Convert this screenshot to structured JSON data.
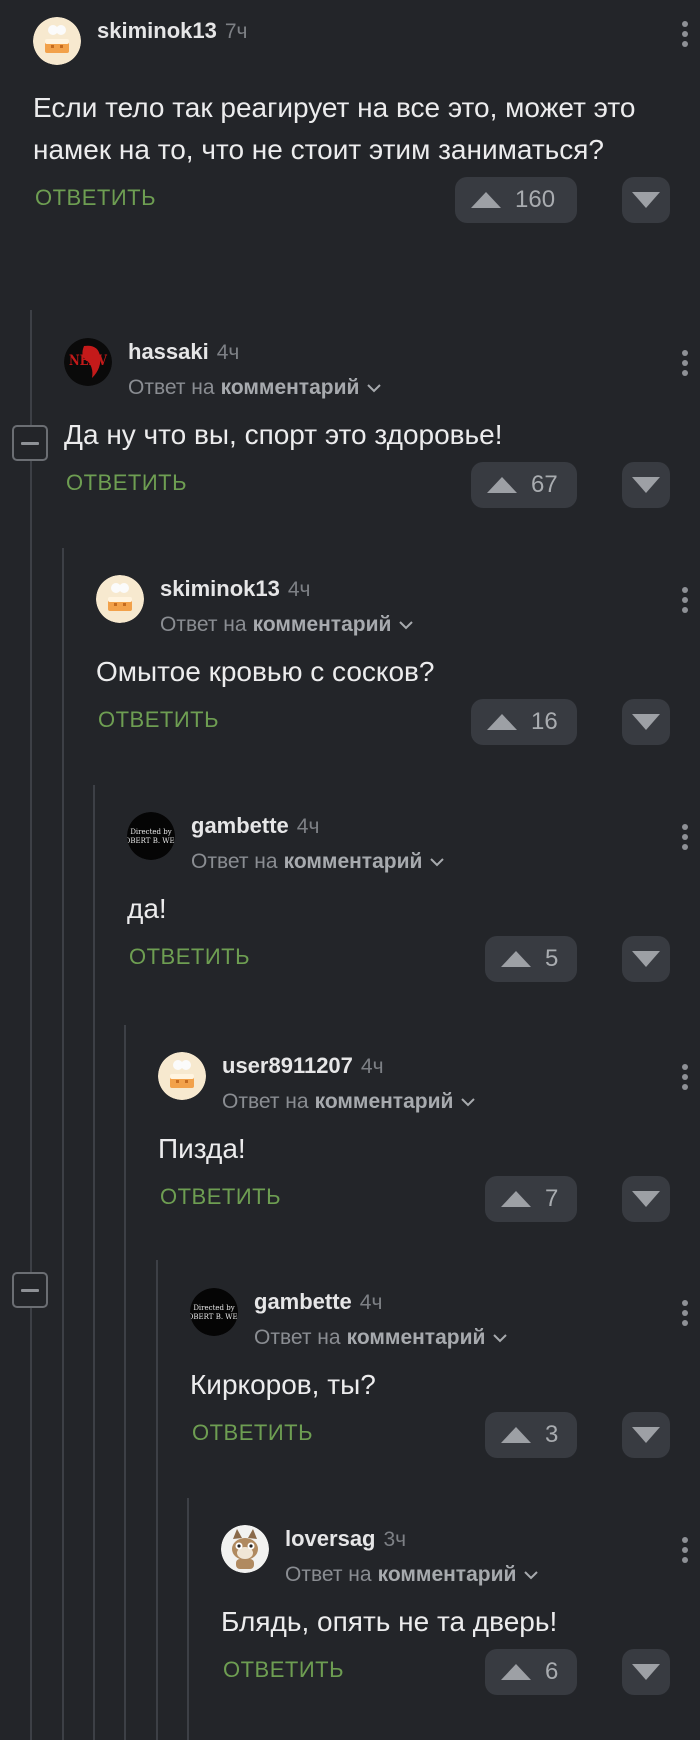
{
  "reply_link_label": "комментарий",
  "reply_prefix": "Ответ на",
  "reply_action": "ОТВЕТИТЬ",
  "comments": [
    {
      "username": "skiminok13",
      "time": "7ч",
      "text": "Если тело так реагирует на все это, может это намек на то, что не стоит этим заниматься?",
      "votes": "160",
      "avatar": "cake-avatar"
    },
    {
      "username": "hassaki",
      "time": "4ч",
      "text": "Да ну что вы, спорт это здоровье!",
      "votes": "67",
      "avatar": "nerv-avatar"
    },
    {
      "username": "skiminok13",
      "time": "4ч",
      "text": "Омытое кровью с сосков?",
      "votes": "16",
      "avatar": "cake-avatar"
    },
    {
      "username": "gambette",
      "time": "4ч",
      "text": "да!",
      "votes": "5",
      "avatar": "film-avatar"
    },
    {
      "username": "user8911207",
      "time": "4ч",
      "text": "Пизда!",
      "votes": "7",
      "avatar": "cake-avatar"
    },
    {
      "username": "gambette",
      "time": "4ч",
      "text": "Киркоров, ты?",
      "votes": "3",
      "avatar": "film-avatar"
    },
    {
      "username": "loversag",
      "time": "3ч",
      "text": "Блядь, опять не та дверь!",
      "votes": "6",
      "avatar": "cat-avatar"
    }
  ],
  "avatar_texts": {
    "nerv": "NERV",
    "film": "Directed by OBERT B. WEI"
  },
  "colors": {
    "background": "#232529",
    "accent_green": "#6e9e52",
    "pill": "#383b41"
  }
}
